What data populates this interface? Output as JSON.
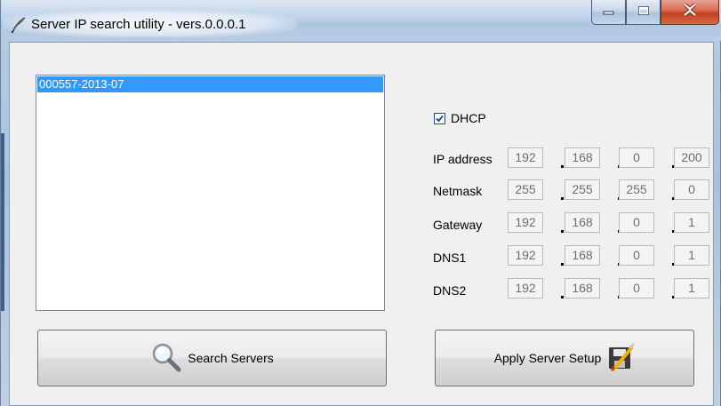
{
  "window": {
    "title": "Server IP search utility - vers.0.0.0.1"
  },
  "server_list": {
    "items": [
      "000557-2013-07"
    ],
    "selected_index": 0
  },
  "network": {
    "dhcp_label": "DHCP",
    "dhcp_checked": true,
    "fields": [
      {
        "label": "IP address",
        "octets": [
          "192",
          "168",
          "0",
          "200"
        ]
      },
      {
        "label": "Netmask",
        "octets": [
          "255",
          "255",
          "255",
          "0"
        ]
      },
      {
        "label": "Gateway",
        "octets": [
          "192",
          "168",
          "0",
          "1"
        ]
      },
      {
        "label": "DNS1",
        "octets": [
          "192",
          "168",
          "0",
          "1"
        ]
      },
      {
        "label": "DNS2",
        "octets": [
          "192",
          "168",
          "0",
          "1"
        ]
      }
    ]
  },
  "buttons": {
    "search_label": "Search Servers",
    "apply_label": "Apply Server Setup"
  },
  "icons": {
    "app": "feather-pen-icon",
    "search": "magnifier-icon",
    "apply": "save-edit-icon"
  },
  "colors": {
    "selection": "#3399ff",
    "close_button": "#c2401f"
  }
}
